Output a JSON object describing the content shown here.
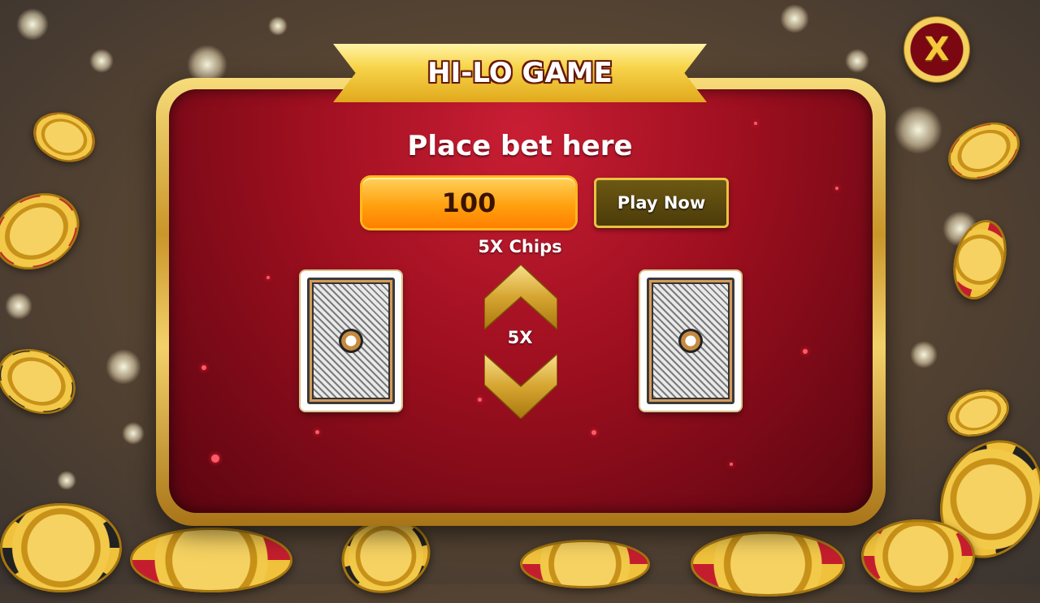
{
  "game": {
    "title": "HI-LO GAME",
    "close_label": "X"
  },
  "bet": {
    "heading": "Place bet here",
    "amount": "100",
    "play_label": "Play Now",
    "chips_label": "5X Chips",
    "multiplier": "5X"
  },
  "cards": {
    "left": "card-back",
    "right": "card-back"
  },
  "icons": {
    "higher": "chevron-up-icon",
    "lower": "chevron-down-icon",
    "close": "close-icon"
  },
  "colors": {
    "panel_red": "#9d0f1f",
    "gold": "#f3cf5c",
    "bet_orange": "#ffa10f",
    "play_brown": "#4a3a08"
  }
}
